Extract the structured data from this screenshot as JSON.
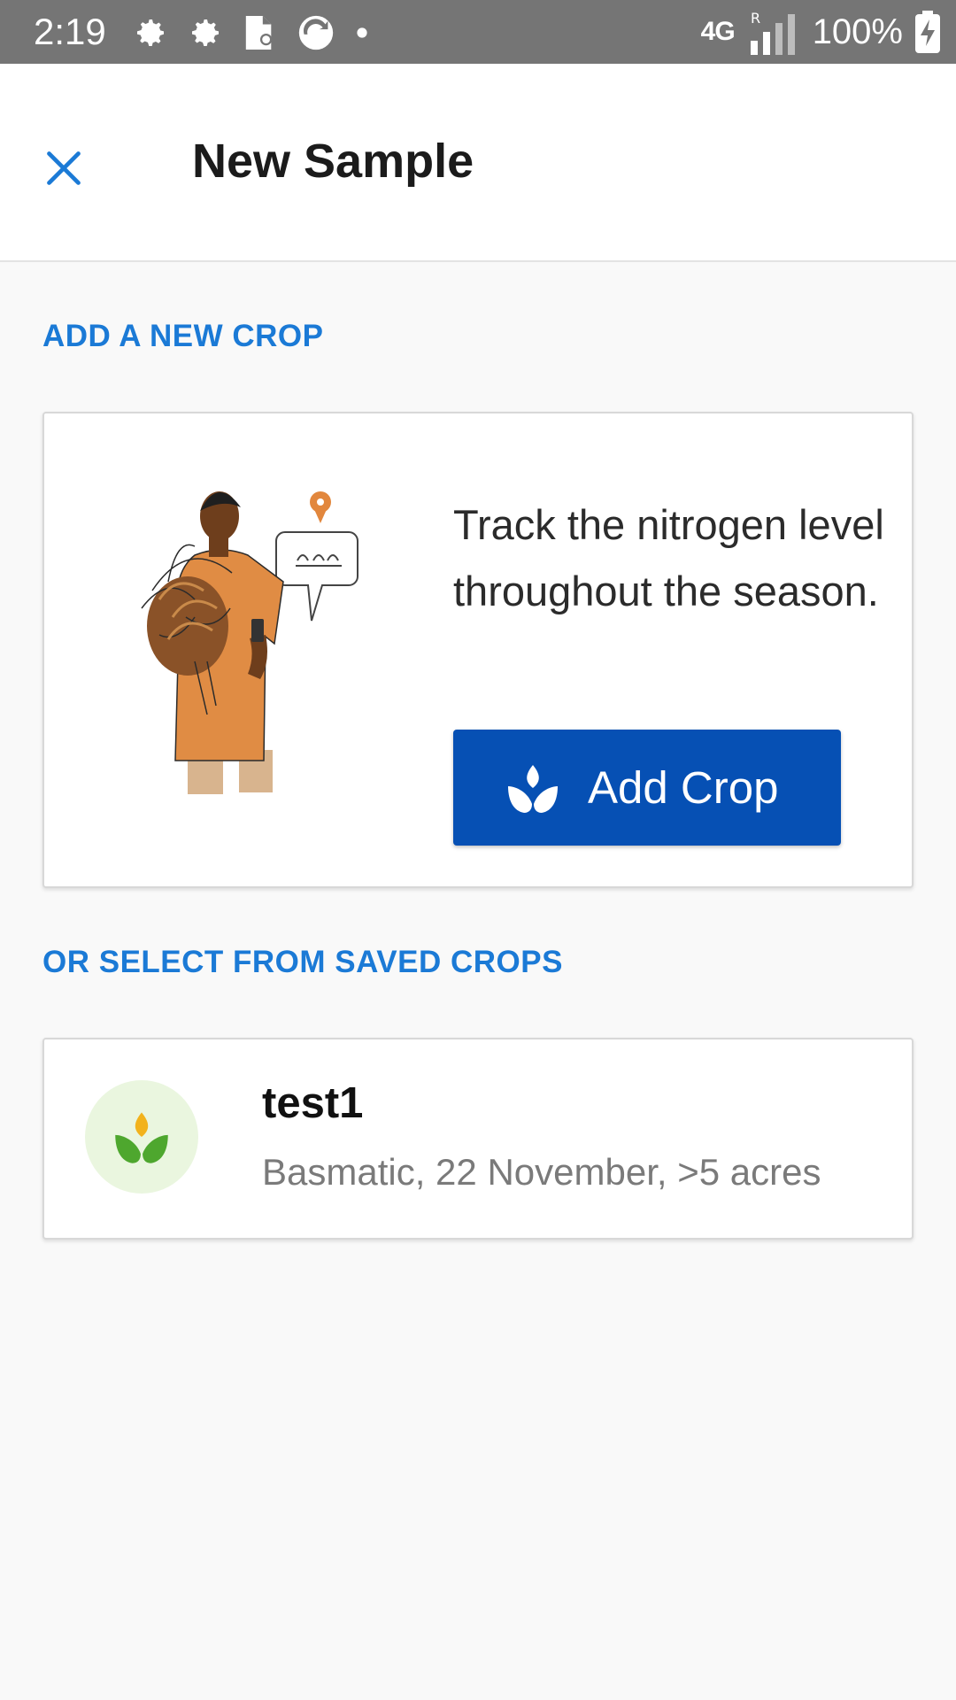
{
  "status_bar": {
    "time": "2:19",
    "network": "4G",
    "roaming": "R",
    "battery": "100%"
  },
  "header": {
    "title": "New Sample",
    "close_icon": "close-icon"
  },
  "add_section": {
    "label": "ADD A NEW CROP",
    "description": "Track the nitrogen level throughout the season.",
    "button_label": "Add Crop",
    "button_icon": "sprout-icon"
  },
  "saved_section": {
    "label": "OR SELECT FROM SAVED CROPS",
    "crops": [
      {
        "name": "test1",
        "details": "Basmatic, 22 November, >5 acres",
        "icon": "plant-icon"
      }
    ]
  },
  "colors": {
    "accent": "#1b7ad6",
    "button": "#0650b4",
    "status_bar": "#757575"
  }
}
